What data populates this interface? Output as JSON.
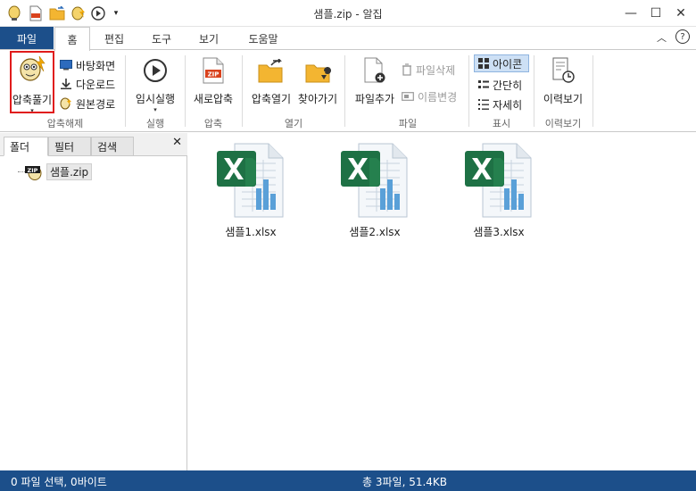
{
  "window": {
    "title": "샘플.zip - 알집",
    "controls": [
      "minimize",
      "maximize",
      "close"
    ]
  },
  "quick_access": [
    "alzip-logo-icon",
    "zip-file-icon",
    "folder-open-icon",
    "extract-icon",
    "run-icon",
    "customize-dropdown-icon"
  ],
  "tabs": {
    "file": "파일",
    "items": [
      "홈",
      "편집",
      "도구",
      "보기",
      "도움말"
    ],
    "active": "홈"
  },
  "ribbon": {
    "extract": {
      "group": "압축해제",
      "main_label": "압축풀기",
      "desktop": "바탕화면",
      "download": "다운로드",
      "original": "원본경로"
    },
    "run": {
      "group": "실행",
      "label": "임시실행"
    },
    "compress": {
      "group": "압축",
      "label": "새로압축"
    },
    "open": {
      "group": "열기",
      "open_archive": "압축열기",
      "find": "찾아가기"
    },
    "file": {
      "group": "파일",
      "add": "파일추가",
      "delete": "파일삭제",
      "rename": "이름변경"
    },
    "view": {
      "group": "표시",
      "icon": "아이콘",
      "simple": "간단히",
      "detail": "자세히",
      "selected": "아이콘"
    },
    "history": {
      "group": "이력보기",
      "label": "이력보기"
    }
  },
  "left_pane": {
    "tabs": [
      "폴더",
      "필터",
      "검색"
    ],
    "active_tab": "폴더",
    "tree_item": "샘플.zip",
    "zip_badge": "ZIP"
  },
  "files": [
    {
      "name": "샘플1.xlsx"
    },
    {
      "name": "샘플2.xlsx"
    },
    {
      "name": "샘플3.xlsx"
    }
  ],
  "status": {
    "left": "0 파일 선택, 0바이트",
    "right": "총 3파일, 51.4KB"
  },
  "colors": {
    "accent": "#1c4f8a",
    "highlight": "#e01b1b",
    "excel_green": "#1e7145",
    "chart_blue": "#5aa0d8"
  }
}
